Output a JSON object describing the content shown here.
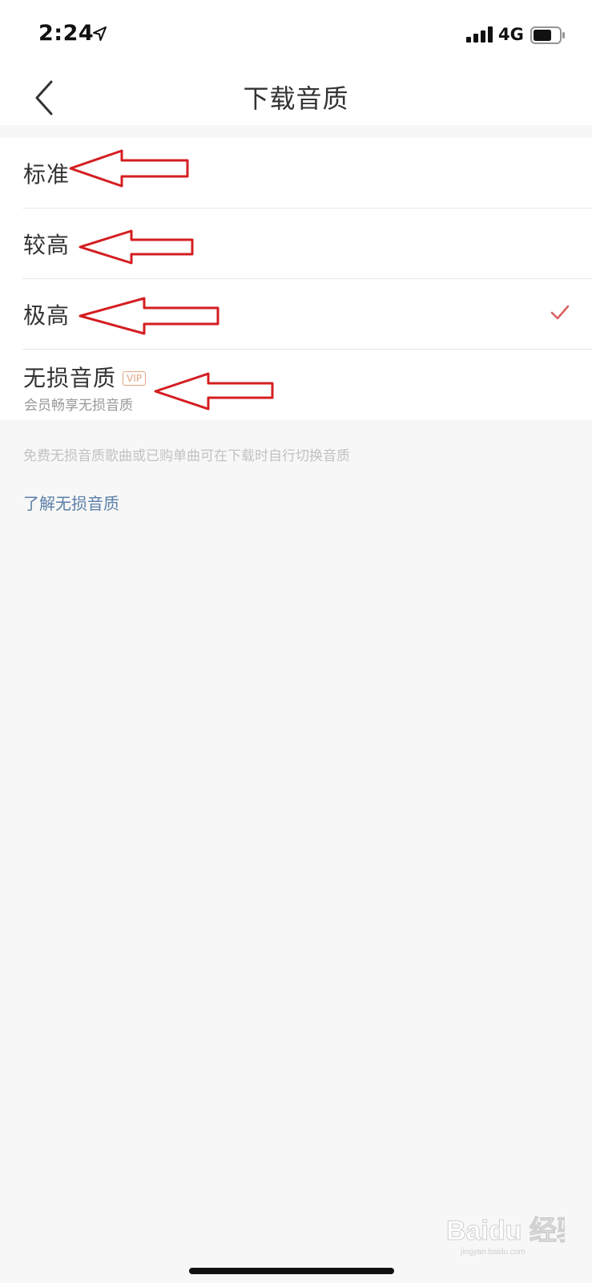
{
  "status_bar": {
    "time": "2:24",
    "network": "4G"
  },
  "nav": {
    "title": "下载音质"
  },
  "options": [
    {
      "label": "标准",
      "selected": false
    },
    {
      "label": "较高",
      "selected": false
    },
    {
      "label": "极高",
      "selected": true
    },
    {
      "label": "无损音质",
      "badge": "VIP",
      "subtitle": "会员畅享无损音质",
      "selected": false
    }
  ],
  "footer": {
    "note": "免费无损音质歌曲或已购单曲可在下载时自行切换音质",
    "link": "了解无损音质"
  },
  "watermark": {
    "text": "Baidu 经验",
    "url_text": "jingyan.baidu.com"
  },
  "colors": {
    "accent": "#d95f5f",
    "annotation": "#d41e22",
    "link": "#5b7fa8"
  },
  "icons": [
    "location-icon",
    "signal-icon",
    "battery-icon",
    "back-chevron-icon",
    "checkmark-icon",
    "arrow-annotation"
  ]
}
